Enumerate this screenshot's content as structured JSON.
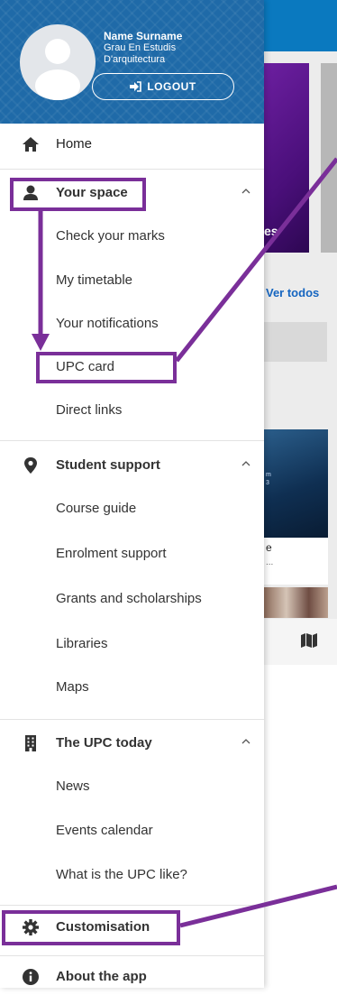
{
  "colors": {
    "header_blue": "#1f6aa8",
    "annotation_purple": "#7a2f99",
    "icon_dark": "#333333"
  },
  "user": {
    "name": "Name Surname",
    "degree": "Grau En Estudis D'arquitectura",
    "logout_label": "LOGOUT"
  },
  "menu": {
    "home": {
      "label": "Home",
      "icon": "home-icon"
    },
    "your_space": {
      "label": "Your space",
      "icon": "person-icon",
      "expanded": true,
      "items": [
        "Check your marks",
        "My timetable",
        "Your notifications",
        "UPC card",
        "Direct links"
      ]
    },
    "student_support": {
      "label": "Student support",
      "icon": "location-pin-icon",
      "expanded": true,
      "items": [
        "Course guide",
        "Enrolment support",
        "Grants and scholarships",
        "Libraries",
        "Maps"
      ]
    },
    "upc_today": {
      "label": "The UPC today",
      "icon": "building-icon",
      "expanded": true,
      "items": [
        "News",
        "Events calendar",
        "What is the UPC like?"
      ]
    },
    "customisation": {
      "label": "Customisation",
      "icon": "gear-icon"
    },
    "about": {
      "label": "About the app",
      "icon": "info-icon"
    }
  },
  "background": {
    "card_caption": "es",
    "ver_todos": "Ver todos",
    "card_small_text": "m\n3",
    "white_card_title": "e",
    "white_card_sub": "..."
  }
}
